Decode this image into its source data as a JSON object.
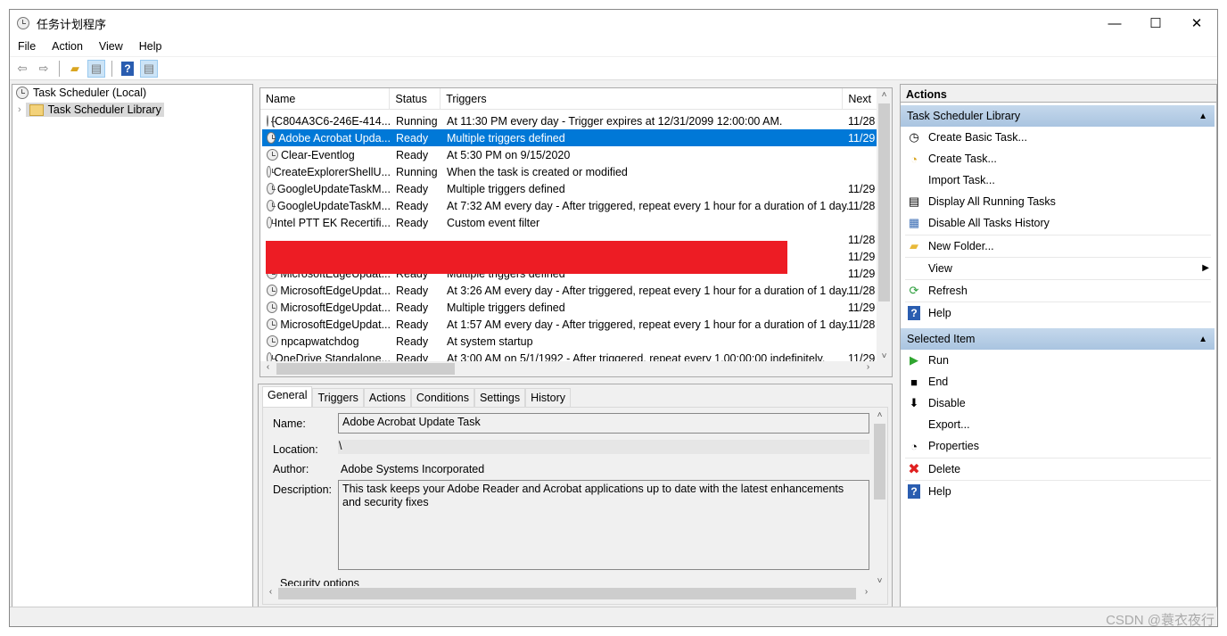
{
  "window": {
    "title": "任务计划程序",
    "minimize": "—",
    "maximize": "☐",
    "close": "✕"
  },
  "menu": [
    "File",
    "Action",
    "View",
    "Help"
  ],
  "tree": {
    "root": "Task Scheduler (Local)",
    "library": "Task Scheduler Library"
  },
  "table": {
    "columns": [
      "Name",
      "Status",
      "Triggers",
      "Next"
    ],
    "rows": [
      {
        "name": "{C804A3C6-246E-414...",
        "status": "Running",
        "trigger": "At 11:30 PM every day - Trigger expires at 12/31/2099 12:00:00 AM.",
        "next": "11/28"
      },
      {
        "name": "Adobe Acrobat Upda...",
        "status": "Ready",
        "trigger": "Multiple triggers defined",
        "next": "11/29"
      },
      {
        "name": "Clear-Eventlog",
        "status": "Ready",
        "trigger": "At 5:30 PM on 9/15/2020",
        "next": ""
      },
      {
        "name": "CreateExplorerShellU...",
        "status": "Running",
        "trigger": "When the task is created or modified",
        "next": ""
      },
      {
        "name": "GoogleUpdateTaskM...",
        "status": "Ready",
        "trigger": "Multiple triggers defined",
        "next": "11/29"
      },
      {
        "name": "GoogleUpdateTaskM...",
        "status": "Ready",
        "trigger": "At 7:32 AM every day - After triggered, repeat every 1 hour for a duration of 1 day.",
        "next": "11/28"
      },
      {
        "name": "Intel PTT EK Recertifi...",
        "status": "Ready",
        "trigger": "Custom event filter",
        "next": ""
      },
      {
        "name": "",
        "status": "",
        "trigger": "",
        "next": "11/28"
      },
      {
        "name": "",
        "status": "",
        "trigger": "",
        "next": "11/29"
      },
      {
        "name": "MicrosoftEdgeUpdat...",
        "status": "Ready",
        "trigger": "Multiple triggers defined",
        "next": "11/29"
      },
      {
        "name": "MicrosoftEdgeUpdat...",
        "status": "Ready",
        "trigger": "At 3:26 AM every day - After triggered, repeat every 1 hour for a duration of 1 day.",
        "next": "11/28"
      },
      {
        "name": "MicrosoftEdgeUpdat...",
        "status": "Ready",
        "trigger": "Multiple triggers defined",
        "next": "11/29"
      },
      {
        "name": "MicrosoftEdgeUpdat...",
        "status": "Ready",
        "trigger": "At 1:57 AM every day - After triggered, repeat every 1 hour for a duration of 1 day.",
        "next": "11/28"
      },
      {
        "name": "npcapwatchdog",
        "status": "Ready",
        "trigger": "At system startup",
        "next": ""
      },
      {
        "name": "OneDrive Standalone...",
        "status": "Ready",
        "trigger": "At 3:00 AM on 5/1/1992 - After triggered, repeat every 1.00:00:00 indefinitely.",
        "next": "11/29"
      }
    ],
    "selected_index": 1,
    "redaction_color": "#ed1c24"
  },
  "details": {
    "tabs": [
      "General",
      "Triggers",
      "Actions",
      "Conditions",
      "Settings",
      "History"
    ],
    "active_tab": "General",
    "name_label": "Name:",
    "name": "Adobe Acrobat Update Task",
    "location_label": "Location:",
    "location": "\\",
    "author_label": "Author:",
    "author": "Adobe Systems Incorporated",
    "description_label": "Description:",
    "description": "This task keeps your Adobe Reader and Acrobat applications up to date with the latest enhancements and security fixes",
    "security_label": "Security options"
  },
  "actions": {
    "title": "Actions",
    "section1": "Task Scheduler Library",
    "items1": [
      "Create Basic Task...",
      "Create Task...",
      "Import Task...",
      "Display All Running Tasks",
      "Disable All Tasks History",
      "New Folder...",
      "View",
      "Refresh",
      "Help"
    ],
    "section2": "Selected Item",
    "items2": [
      "Run",
      "End",
      "Disable",
      "Export...",
      "Properties",
      "Delete",
      "Help"
    ]
  },
  "watermark": "CSDN @蓑衣夜行",
  "colors": {
    "selection": "#0078d7",
    "section_header": "#b4cce6"
  }
}
